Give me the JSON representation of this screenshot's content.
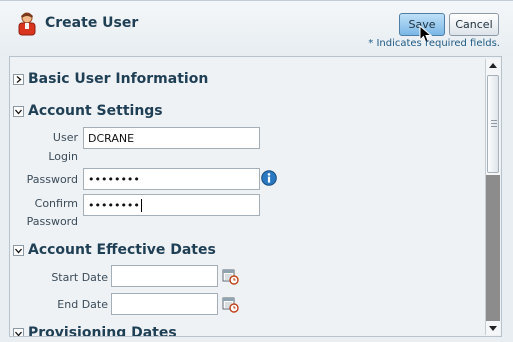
{
  "header": {
    "title": "Create User",
    "save_label": "Save",
    "cancel_label": "Cancel",
    "required_note": "* Indicates required fields."
  },
  "sections": {
    "basic": "Basic User Information",
    "account": "Account Settings",
    "dates": "Account Effective Dates",
    "provisioning": "Provisioning Dates"
  },
  "fields": {
    "user_login": {
      "label_line1": "User",
      "label_line2": "Login",
      "value": "DCRANE"
    },
    "password": {
      "label": "Password",
      "value": "••••••••"
    },
    "confirm_password": {
      "label_line1": "Confirm",
      "label_line2": "Password",
      "value": "••••••••"
    },
    "start_date": {
      "label": "Start Date",
      "value": ""
    },
    "end_date": {
      "label": "End Date",
      "value": ""
    }
  },
  "colors": {
    "title": "#1f3f55",
    "accent": "#2a78c0",
    "note": "#1e5a84"
  },
  "icons": [
    "user-icon",
    "info-icon",
    "calendar-icon",
    "mouse-cursor-icon"
  ]
}
